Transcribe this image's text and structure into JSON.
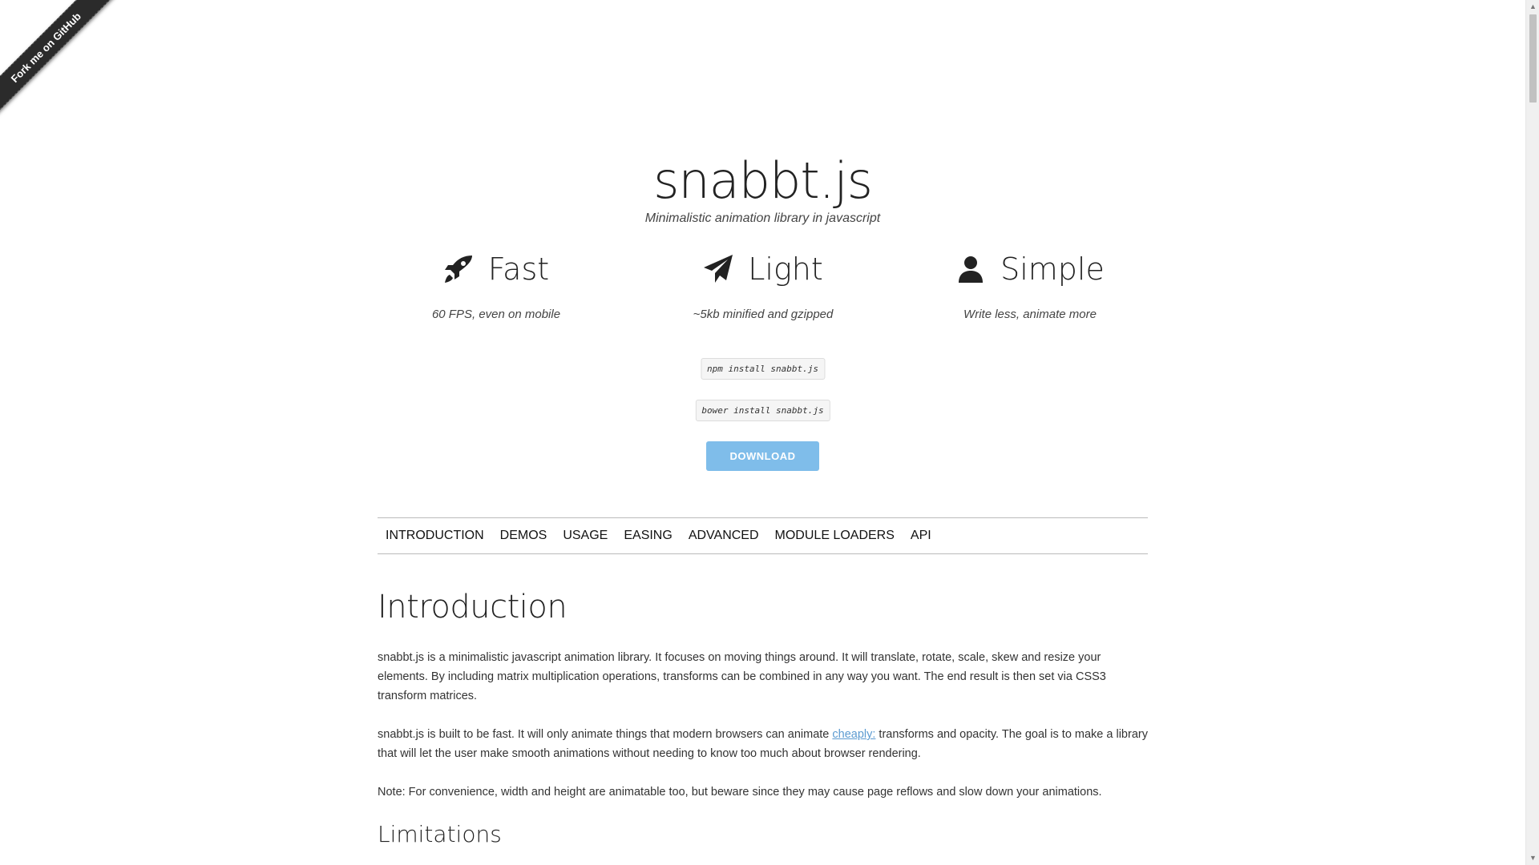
{
  "ribbon": {
    "label": "Fork me on GitHub"
  },
  "header": {
    "title": "snabbt.js",
    "tagline": "Minimalistic animation library in javascript"
  },
  "features": [
    {
      "icon": "rocket-icon",
      "title": "Fast",
      "desc": "60 FPS, even on mobile"
    },
    {
      "icon": "paper-plane-icon",
      "title": "Light",
      "desc": "~5kb minified and gzipped"
    },
    {
      "icon": "user-icon",
      "title": "Simple",
      "desc": "Write less, animate more"
    }
  ],
  "install": {
    "npm": "npm install snabbt.js",
    "bower": "bower install snabbt.js",
    "download_label": "DOWNLOAD"
  },
  "nav": {
    "items": [
      "INTRODUCTION",
      "DEMOS",
      "USAGE",
      "EASING",
      "ADVANCED",
      "MODULE LOADERS",
      "API"
    ]
  },
  "content": {
    "heading": "Introduction",
    "p1": "snabbt.js is a minimalistic javascript animation library. It focuses on moving things around. It will translate, rotate, scale, skew and resize your elements. By including matrix multiplication operations, transforms can be combined in any way you want. The end result is then set via CSS3 transform matrices.",
    "p2_before": "snabbt.js is built to be fast. It will only animate things that modern browsers can animate ",
    "p2_link": "cheaply:",
    "p2_after": " transforms and opacity. The goal is to make a library that will let the user make smooth animations without needing to know too much about browser rendering.",
    "p3": "Note: For convenience, width and height are animatable too, but beware since they may cause page reflows and slow down your animations.",
    "subheading": "Limitations"
  },
  "colors": {
    "download_button": "#7fbdea",
    "link": "#5c9bd1",
    "ribbon": "#2b2b2b"
  }
}
